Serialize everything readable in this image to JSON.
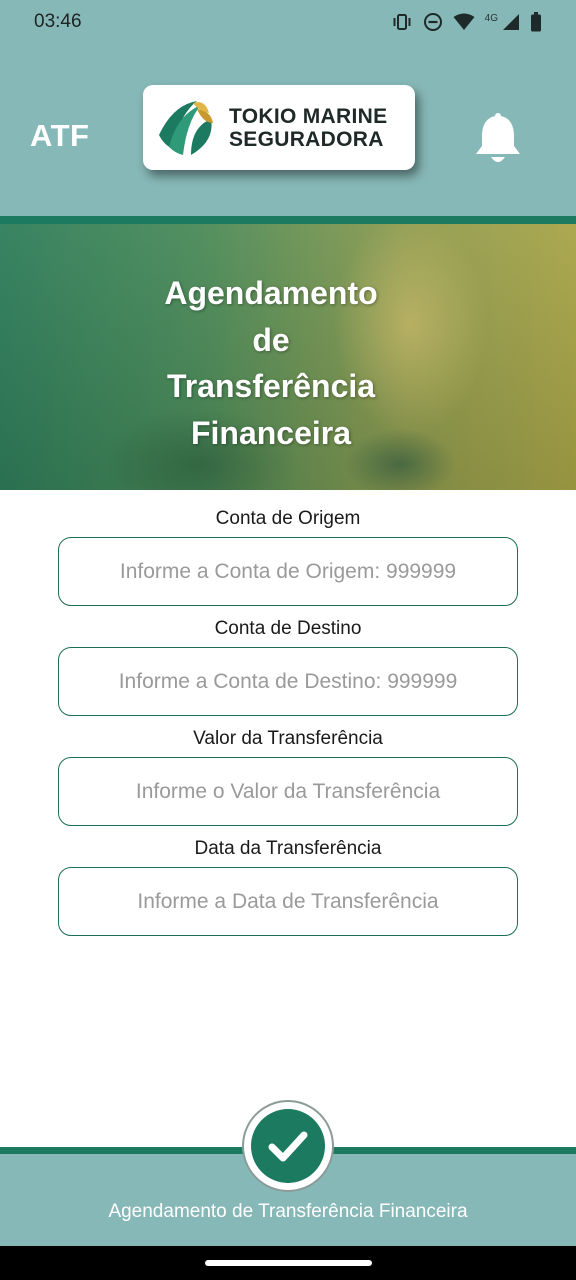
{
  "status_bar": {
    "time": "03:46",
    "network_label": "4G",
    "icons": [
      "vibrate-icon",
      "do-not-disturb-icon",
      "wifi-icon",
      "cell-signal-icon",
      "battery-icon"
    ]
  },
  "header": {
    "app_abbr": "ATF",
    "logo": {
      "line1": "TOKIO MARINE",
      "line2": "SEGURADORA"
    },
    "notification_icon": "bell-icon"
  },
  "hero": {
    "title_lines": [
      "Agendamento",
      "de",
      "Transferência",
      "Financeira"
    ]
  },
  "form": {
    "origin": {
      "label": "Conta de Origem",
      "placeholder": "Informe a Conta de Origem: 999999",
      "value": ""
    },
    "destination": {
      "label": "Conta de Destino",
      "placeholder": "Informe a Conta de Destino: 999999",
      "value": ""
    },
    "amount": {
      "label": "Valor da Transferência",
      "placeholder": "Informe o Valor da Transferência",
      "value": ""
    },
    "date": {
      "label": "Data da Transferência",
      "placeholder": "Informe a Data de Transferência",
      "value": ""
    }
  },
  "footer": {
    "confirm_icon": "checkmark-icon",
    "label": "Agendamento de Transferência Financeira"
  },
  "colors": {
    "header_bg": "#86b8b7",
    "accent_green": "#1b7a60",
    "input_border": "#1b6e57"
  }
}
